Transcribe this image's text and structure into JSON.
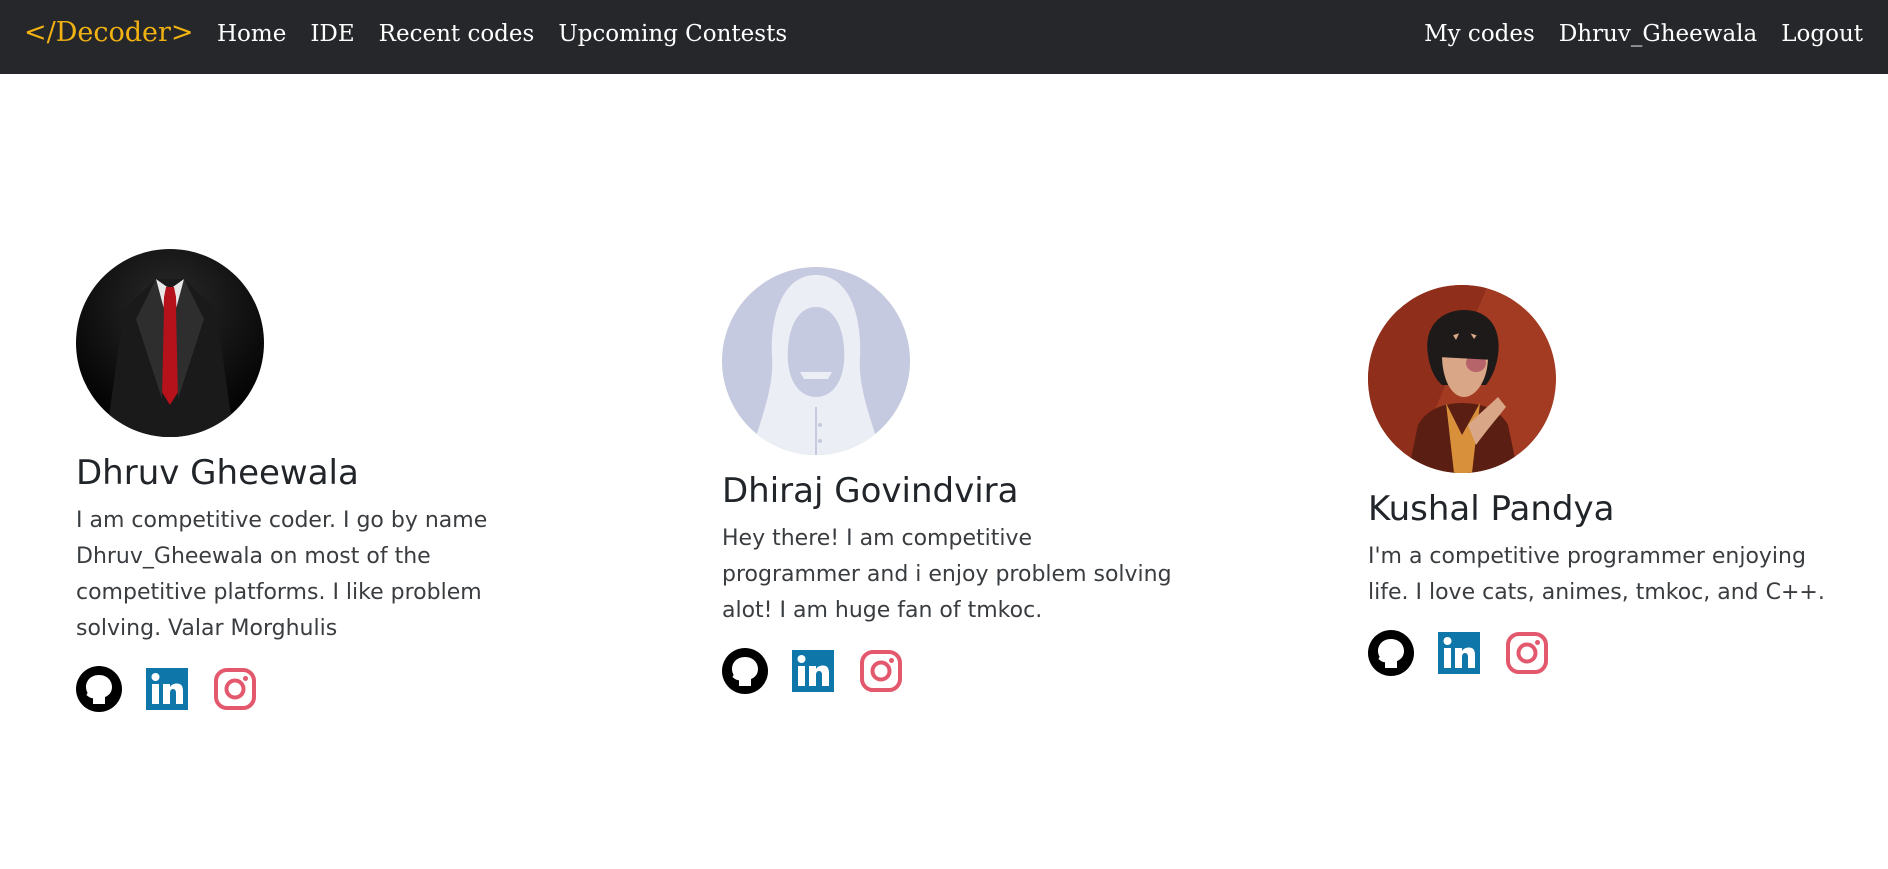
{
  "navbar": {
    "brand": "</Decoder>",
    "left_links": [
      "Home",
      "IDE",
      "Recent codes",
      "Upcoming Contests"
    ],
    "right_links": [
      "My codes",
      "Dhruv_Gheewala",
      "Logout"
    ],
    "brand_color": "#f2b211",
    "background": "#25272b"
  },
  "team": [
    {
      "name": "Dhruv Gheewala",
      "bio": "I am competitive coder. I go by name Dhruv_Gheewala on most of the competitive platforms. I like problem solving. Valar Morghulis",
      "avatar": "suit-with-red-tie-avatar",
      "socials": [
        "github-icon",
        "linkedin-icon",
        "instagram-icon"
      ]
    },
    {
      "name": "Dhiraj Govindvira",
      "bio": "Hey there! I am competitive programmer and i enjoy problem solving alot! I am huge fan of tmkoc.",
      "avatar": "hooded-figure-avatar",
      "socials": [
        "github-icon",
        "linkedin-icon",
        "instagram-icon"
      ]
    },
    {
      "name": "Kushal Pandya",
      "bio": "I'm a competitive programmer enjoying life. I love cats, animes, tmkoc, and C++.",
      "avatar": "anime-character-avatar",
      "socials": [
        "github-icon",
        "linkedin-icon",
        "instagram-icon"
      ]
    }
  ],
  "colors": {
    "github": "#000000",
    "linkedin": "#0e76a8",
    "instagram": "#e4586d"
  }
}
